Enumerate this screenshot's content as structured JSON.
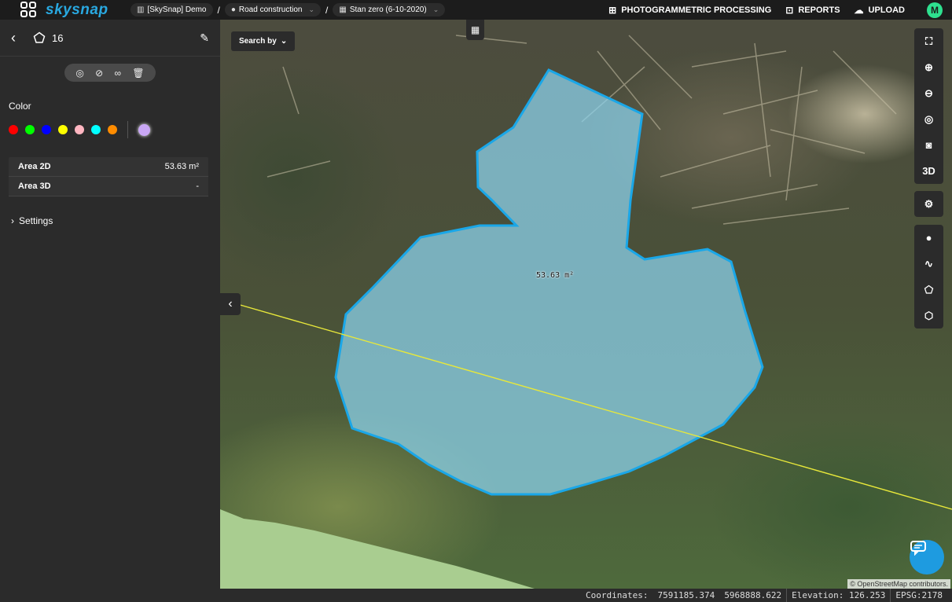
{
  "app": {
    "logo_text": "skysnap"
  },
  "breadcrumbs": [
    {
      "label": "[SkySnap] Demo",
      "icon": "building-icon"
    },
    {
      "label": "Road construction",
      "icon": "location-pin-icon"
    },
    {
      "label": "Stan zero (6-10-2020)",
      "icon": "calendar-icon"
    }
  ],
  "top_actions": {
    "processing": "PHOTOGRAMMETRIC PROCESSING",
    "reports": "REPORTS",
    "upload": "UPLOAD",
    "avatar": "M"
  },
  "sidebar": {
    "title": "16",
    "color_label": "Color",
    "colors": [
      "#ff0000",
      "#00ff00",
      "#0000ff",
      "#ffff00",
      "#ffb6c1",
      "#00ffff",
      "#ff8c00"
    ],
    "selected_color": "#c9a7f5",
    "props": [
      {
        "key": "Area 2D",
        "value": "53.63 m²"
      },
      {
        "key": "Area 3D",
        "value": "-"
      }
    ],
    "settings_label": "Settings"
  },
  "map": {
    "search_label": "Search by",
    "area_label": "53.63 m²",
    "polygon_fill": "#8ed6f0",
    "polygon_stroke": "#1aa7e8",
    "line_color": "#e8e83a",
    "osm_credit": "© OpenStreetMap contributors.",
    "right_tools_3d": "3D"
  },
  "status": {
    "coords_label": "Coordinates:",
    "x": "7591185.374",
    "y": "5968888.622",
    "elevation": "Elevation: 126.253",
    "epsg": "EPSG:2178"
  }
}
